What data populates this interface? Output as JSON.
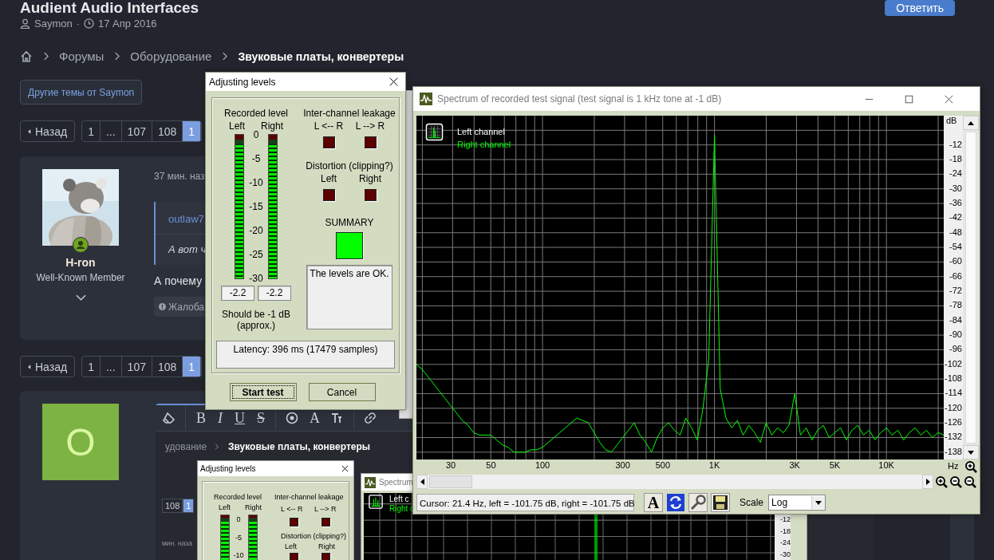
{
  "page": {
    "title": "Audient Audio Interfaces",
    "author": "Saymon",
    "separator": "·",
    "date": "17 Апр 2016",
    "reply_button": "Ответить",
    "breadcrumbs": [
      {
        "label": "Форумы",
        "current": false
      },
      {
        "label": "Оборудование",
        "current": false
      },
      {
        "label": "Звуковые платы, конвертеры",
        "current": true
      }
    ],
    "other_topics_button": "Другие темы от Saymon",
    "pagination_top": {
      "prev": "Назад",
      "pages": [
        {
          "label": "1",
          "selected": false
        },
        {
          "label": "...",
          "selected": false
        },
        {
          "label": "107",
          "selected": false
        },
        {
          "label": "108",
          "selected": false
        },
        {
          "label": "1",
          "selected": true
        }
      ]
    },
    "post": {
      "username": "H-ron",
      "user_title": "Well-Known Member",
      "online": true,
      "time": "37 мин. наз",
      "quote_author": "outlaw7",
      "quote_text": "А вот ч",
      "body": "А почему",
      "report_button": "Жалоба"
    },
    "pagination_bottom": {
      "prev": "Назад",
      "pages": [
        {
          "label": "1",
          "selected": false
        },
        {
          "label": "...",
          "selected": false
        },
        {
          "label": "107",
          "selected": false
        },
        {
          "label": "108",
          "selected": false
        },
        {
          "label": "1",
          "selected": true
        }
      ]
    },
    "reply_box": {
      "avatar_letter": "O",
      "toolbar": [
        {
          "kind": "eraser"
        },
        {
          "kind": "bold",
          "label": "B"
        },
        {
          "kind": "italic",
          "label": "I"
        },
        {
          "kind": "underline",
          "label": "U"
        },
        {
          "kind": "strike",
          "label": "S"
        },
        {
          "kind": "circle"
        },
        {
          "kind": "color",
          "label": "A"
        },
        {
          "kind": "size"
        },
        {
          "kind": "link"
        }
      ]
    }
  },
  "levels_dialog": {
    "title": "Adjusting levels",
    "recorded_label": "Recorded level",
    "meters": [
      {
        "label": "Left",
        "level": 0.93,
        "reading": "-2.2"
      },
      {
        "label": "Right",
        "level": 0.93,
        "reading": "-2.2"
      }
    ],
    "scale": [
      "0",
      "-5",
      "-10",
      "-15",
      "-20",
      "-25",
      "-30"
    ],
    "leakage_label": "Inter-channel leakage",
    "leakage": [
      {
        "label": "L <-- R",
        "on": false
      },
      {
        "label": "L --> R",
        "on": false
      }
    ],
    "distortion_label": "Distortion (clipping?)",
    "distortion": [
      {
        "label": "Left",
        "on": false
      },
      {
        "label": "Right",
        "on": false
      }
    ],
    "summary_label": "SUMMARY",
    "summary_ok": true,
    "message": "The levels are OK.",
    "hint": "Should be  -1 dB",
    "hint_note": "(approx.)",
    "latency": "Latency: 396 ms (17479 samples)",
    "buttons": [
      {
        "label": "Start test",
        "default": true
      },
      {
        "label": "Cancel",
        "default": false
      }
    ]
  },
  "spectrum_window": {
    "title": "Spectrum of recorded test signal (test signal is 1 kHz tone at -1 dB)",
    "legend": [
      {
        "label": "Left channel",
        "color": "#ffffff"
      }
    ],
    "y_unit": "dB",
    "x_unit": "Hz",
    "chart_data": {
      "type": "line",
      "categories": [
        null,
        null,
        null,
        null,
        null,
        null,
        "30",
        null,
        null,
        null,
        null,
        null,
        null,
        "50",
        null,
        null,
        null,
        null,
        null,
        null,
        null,
        null,
        "100",
        null,
        null,
        null,
        null,
        null,
        null,
        null,
        null,
        null,
        null,
        null,
        null,
        null,
        "300",
        null,
        null,
        null,
        null,
        null,
        null,
        "500",
        null,
        null,
        null,
        null,
        null,
        null,
        null,
        null,
        "1K",
        null,
        null,
        null,
        null,
        null,
        null,
        null,
        null,
        null,
        null,
        null,
        null,
        null,
        "3K",
        null,
        null,
        null,
        null,
        null,
        null,
        "5K",
        null,
        null,
        null,
        null,
        null,
        null,
        null,
        null,
        "10K",
        null,
        null,
        null,
        null,
        null,
        null,
        null,
        null,
        null,
        null
      ],
      "series": [
        {
          "name": "Right channel",
          "color": "#00ff00",
          "values": [
            -102,
            -104,
            -107,
            -110,
            -113,
            -116,
            -119,
            -122,
            -125,
            -127,
            -130,
            -131,
            -131,
            -131,
            -133,
            -135,
            -136,
            -138,
            -138,
            -138,
            -137,
            -137,
            -136,
            -134,
            -132,
            -130,
            -128,
            -126,
            -124,
            -125,
            -126,
            -130,
            -134,
            -137,
            -138,
            -135,
            -132,
            -129,
            -126,
            -131,
            -134,
            -138,
            -132,
            -128,
            -126,
            -129,
            -131,
            -124,
            -128,
            -133,
            -120,
            -100,
            -8,
            -112,
            -124,
            -128,
            -125,
            -131,
            -127,
            -130,
            -134,
            -126,
            -131,
            -128,
            -130,
            -127,
            -114,
            -131,
            -128,
            -133,
            -129,
            -127,
            -132,
            -130,
            -128,
            -133,
            -129,
            -127,
            -131,
            -129,
            -133,
            -130,
            -128,
            -131,
            -129,
            -133,
            -130,
            -128,
            -131,
            -129,
            -132,
            -130,
            -131
          ]
        }
      ],
      "ylim": [
        -141,
        0
      ],
      "grid": true,
      "yticks": [
        -12,
        -18,
        -24,
        -30,
        -36,
        -42,
        -48,
        -54,
        -60,
        -66,
        -72,
        -78,
        -84,
        -90,
        -96,
        -102,
        -108,
        -114,
        -120,
        -126,
        -132,
        -138
      ]
    },
    "cursor": "Cursor:  21.4 Hz,  left = -101.75 dB,  right = -101.75 dB",
    "tools": [
      {
        "kind": "font",
        "label": "A"
      },
      {
        "kind": "refresh"
      },
      {
        "kind": "wrench"
      },
      {
        "kind": "save"
      }
    ],
    "scale_label": "Scale",
    "scale_value": "Log"
  },
  "nested_screenshot": {
    "breadcrumb_tail": "удование",
    "breadcrumb_current": "Звуковые платы, конвертеры",
    "pages": [
      {
        "label": "108",
        "selected": false
      },
      {
        "label": "1",
        "selected": true
      }
    ],
    "time": "мин. наза",
    "dialog": {
      "title": "Adjusting levels",
      "recorded_label": "Recorded level",
      "meters": [
        {
          "label": "Left",
          "level": 0.93
        },
        {
          "label": "Right",
          "level": 0.93
        }
      ],
      "scale": [
        "0",
        "-5",
        "-10"
      ],
      "leakage_label": "Inter-channel leakage",
      "leakage": [
        {
          "label": "L <-- R",
          "on": false
        },
        {
          "label": "L --> R",
          "on": false
        }
      ],
      "distortion_label": "Distortion (clipping?)",
      "distortion": [
        {
          "label": "Left",
          "on": false
        },
        {
          "label": "Right",
          "on": false
        }
      ]
    },
    "spectrum": {
      "title": "Spectrum",
      "legend": [
        {
          "label": "Left c",
          "color": "#ffffff"
        },
        {
          "label": "Right c",
          "color": "#00ff00"
        }
      ],
      "y_labels": [
        "-12",
        "-18",
        "-24",
        "-30"
      ]
    }
  }
}
